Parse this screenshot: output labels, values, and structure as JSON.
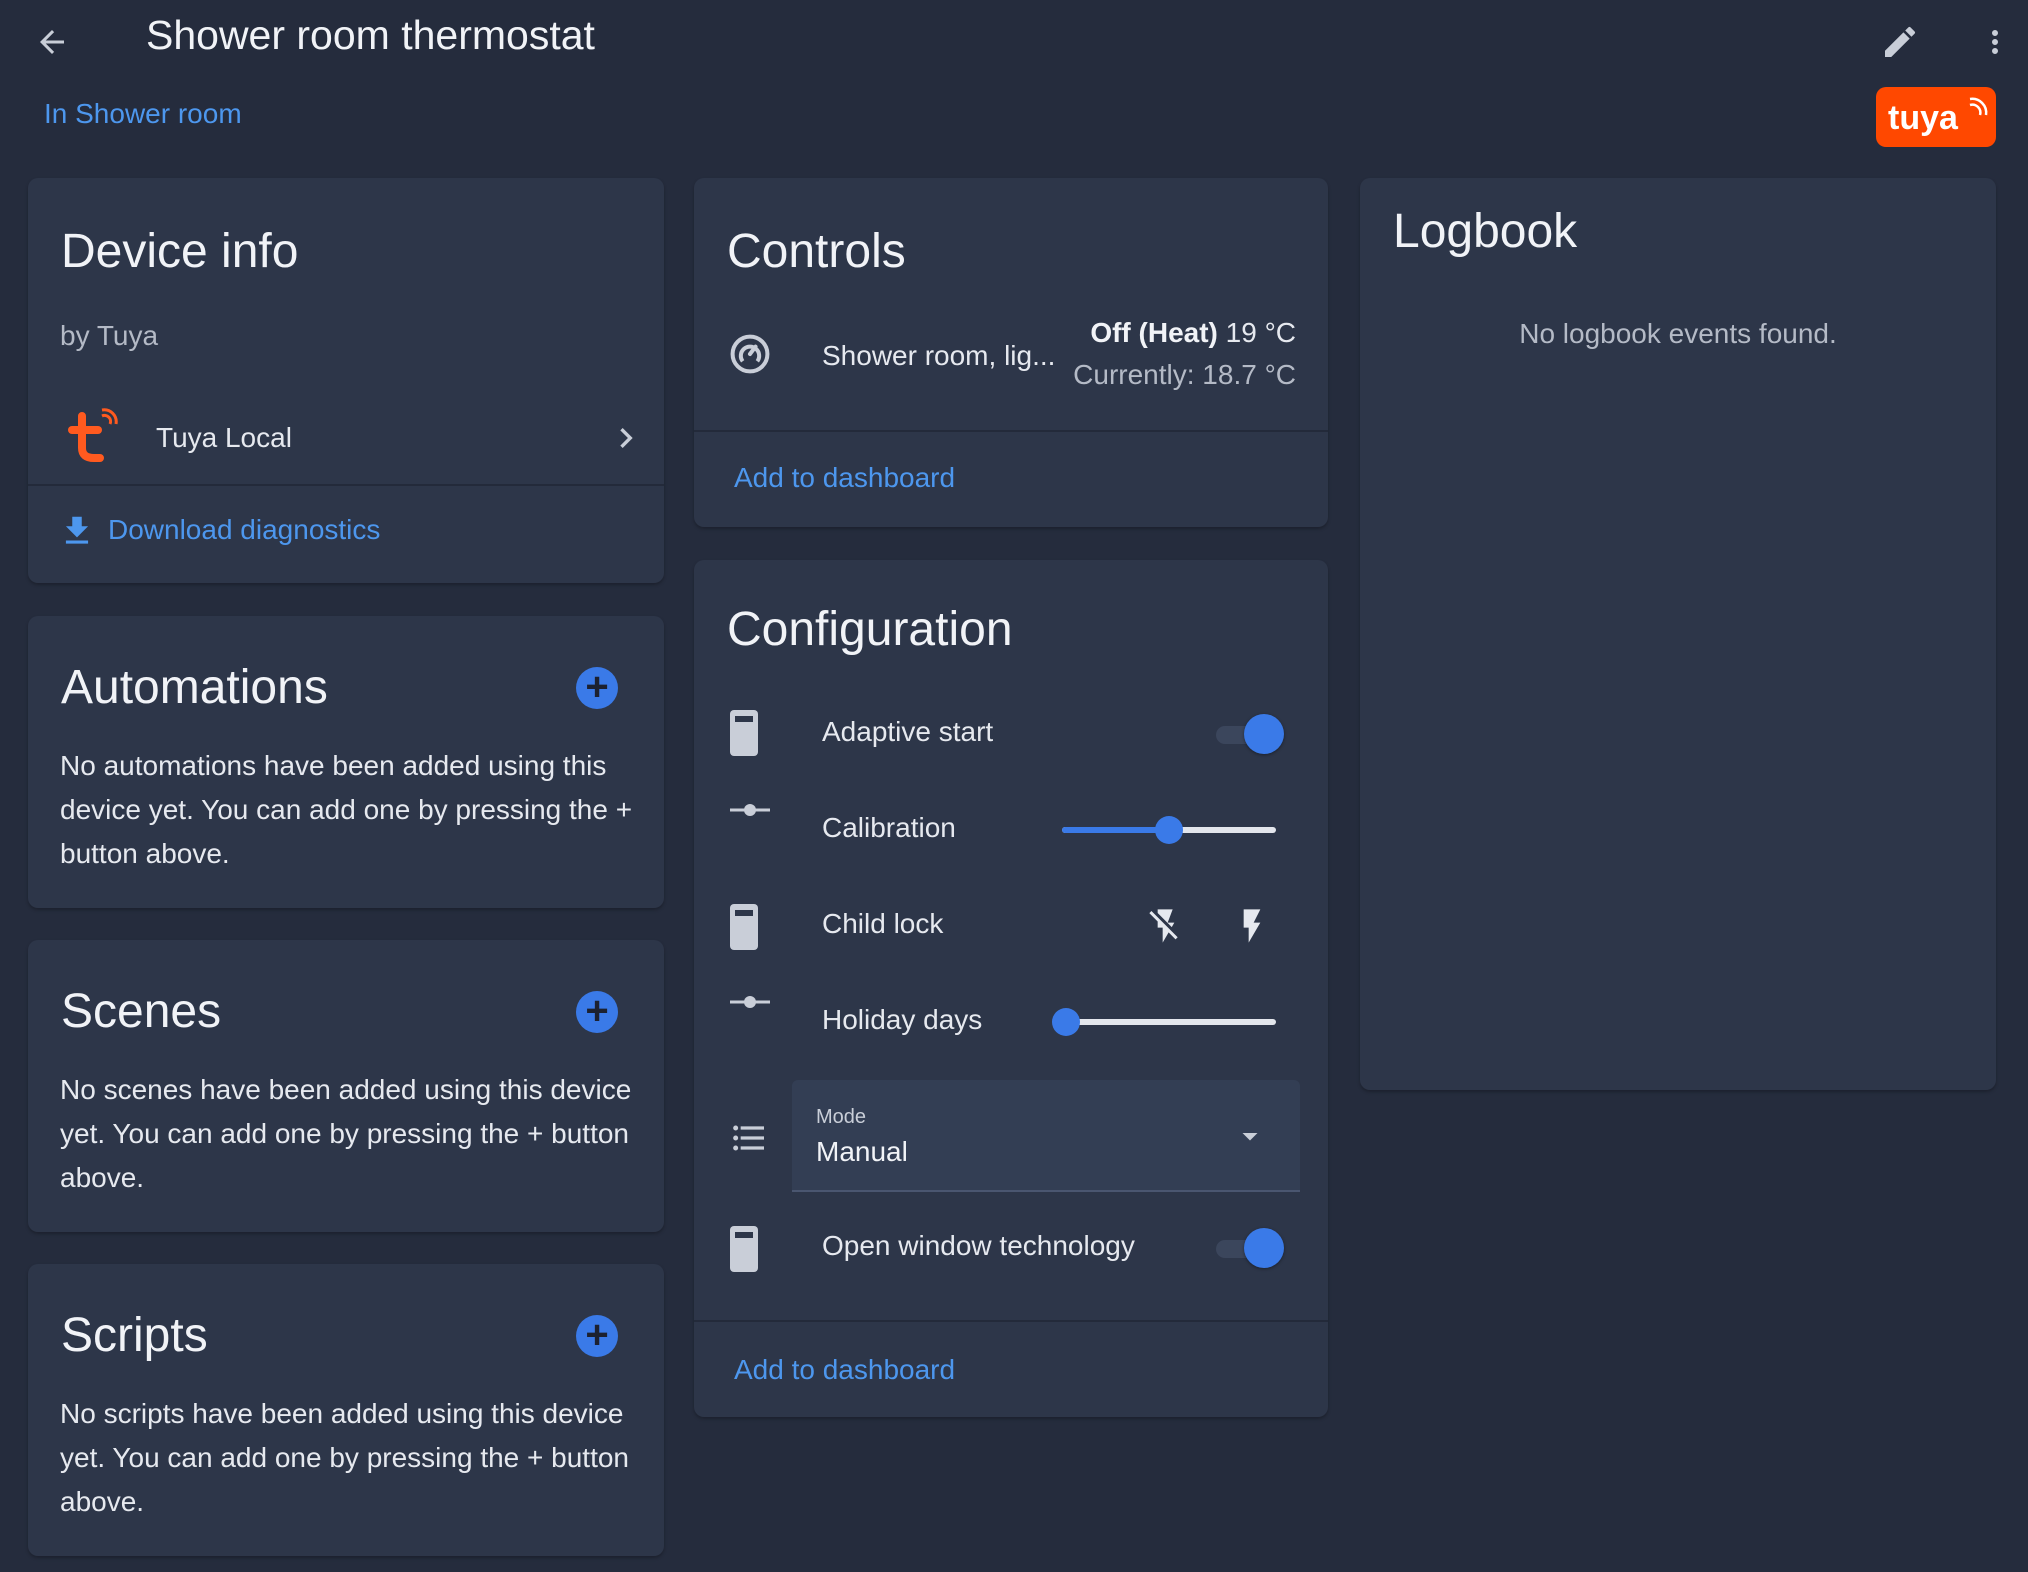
{
  "header": {
    "title": "Shower room thermostat",
    "area_link": "In Shower room",
    "brand": "tuya"
  },
  "device_info": {
    "title": "Device info",
    "manufacturer": "by Tuya",
    "integration": "Tuya Local",
    "download": "Download diagnostics"
  },
  "automations": {
    "title": "Automations",
    "empty_text": "No automations have been added using this device yet. You can add one by pressing the + button above."
  },
  "scenes": {
    "title": "Scenes",
    "empty_text": "No scenes have been added using this device yet. You can add one by pressing the + button above."
  },
  "scripts": {
    "title": "Scripts",
    "empty_text": "No scripts have been added using this device yet. You can add one by pressing the + button above."
  },
  "controls": {
    "title": "Controls",
    "entity_name": "Shower room, lig...",
    "state_main": "Off (Heat)",
    "state_target": "19 °C",
    "state_current": "Currently: 18.7 °C",
    "add_to_dashboard": "Add to dashboard"
  },
  "configuration": {
    "title": "Configuration",
    "adaptive_start": {
      "label": "Adaptive start",
      "on": true
    },
    "calibration": {
      "label": "Calibration",
      "level": 0.5
    },
    "child_lock": {
      "label": "Child lock"
    },
    "holiday_days": {
      "label": "Holiday days",
      "level": 0.0
    },
    "mode": {
      "label": "Mode",
      "value": "Manual"
    },
    "open_window": {
      "label": "Open window technology",
      "on": true
    },
    "add_to_dashboard": "Add to dashboard"
  },
  "logbook": {
    "title": "Logbook",
    "empty_text": "No logbook events found."
  },
  "colors": {
    "background": "#252c3d",
    "card": "#2d3649",
    "accent": "#3a7ae8",
    "link": "#4d97ee",
    "tuya_orange": "#ff4800"
  }
}
